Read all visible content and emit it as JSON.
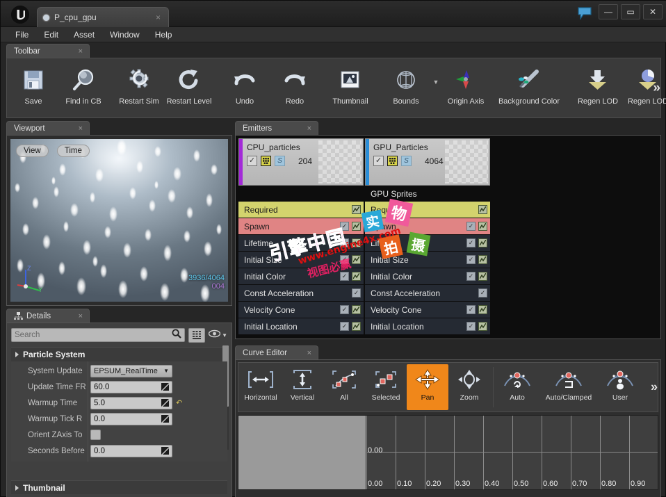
{
  "window": {
    "tab_label": "P_cpu_gpu",
    "tab_close": "×",
    "minimize": "—",
    "maximize": "▭",
    "close": "✕"
  },
  "menubar": {
    "items": [
      {
        "label": "File"
      },
      {
        "label": "Edit"
      },
      {
        "label": "Asset"
      },
      {
        "label": "Window"
      },
      {
        "label": "Help"
      }
    ]
  },
  "toolbar": {
    "tab_label": "Toolbar",
    "tab_close": "×",
    "more": "»",
    "buttons": [
      {
        "label": "Save",
        "icon": "save-icon"
      },
      {
        "label": "Find in CB",
        "icon": "find-in-content-browser-icon"
      },
      {
        "label": "Restart Sim",
        "icon": "restart-sim-icon"
      },
      {
        "label": "Restart Level",
        "icon": "restart-level-icon"
      },
      {
        "label": "Undo",
        "icon": "undo-icon"
      },
      {
        "label": "Redo",
        "icon": "redo-icon"
      },
      {
        "label": "Thumbnail",
        "icon": "thumbnail-icon"
      },
      {
        "label": "Bounds",
        "icon": "bounds-icon"
      },
      {
        "label": "Origin Axis",
        "icon": "origin-axis-icon"
      },
      {
        "label": "Background Color",
        "icon": "background-color-icon"
      },
      {
        "label": "Regen LOD",
        "icon": "regen-lod-down-icon"
      },
      {
        "label": "Regen LOD",
        "icon": "regen-lod-sphere-icon"
      }
    ]
  },
  "viewport": {
    "tab_label": "Viewport",
    "tab_close": "×",
    "view_button": "View",
    "time_button": "Time",
    "stats_line1": "3936/4064",
    "stats_line2": "004",
    "axis_z": "Z",
    "axis_y": "Y"
  },
  "details": {
    "tab_label": "Details",
    "tab_close": "×",
    "search_placeholder": "Search",
    "search_value": "",
    "section_title": "Particle System",
    "footer_title": "Thumbnail",
    "rows": [
      {
        "name": "System Update",
        "type": "combo",
        "value": "EPSUM_RealTime",
        "reset": false
      },
      {
        "name": "Update Time FR",
        "type": "number",
        "value": "60.0",
        "reset": false
      },
      {
        "name": "Warmup Time",
        "type": "number",
        "value": "5.0",
        "reset": true
      },
      {
        "name": "Warmup Tick R",
        "type": "number",
        "value": "0.0",
        "reset": false
      },
      {
        "name": "Orient ZAxis To",
        "type": "checkbox",
        "value": "",
        "reset": false
      },
      {
        "name": "Seconds Before",
        "type": "number",
        "value": "0.0",
        "reset": false
      }
    ]
  },
  "emitters": {
    "tab_label": "Emitters",
    "tab_close": "×",
    "columns": [
      {
        "name": "CPU_particles",
        "count": "204",
        "bar_color": "#a32ad8",
        "enabled": "✓",
        "solo": "S",
        "subhead": "",
        "modules": [
          {
            "label": "Required",
            "style": "required",
            "has_check": false,
            "has_curve": true
          },
          {
            "label": "Spawn",
            "style": "spawn",
            "has_check": true,
            "has_curve": true
          },
          {
            "label": "Lifetime",
            "style": "normal",
            "has_check": true,
            "has_curve": true
          },
          {
            "label": "Initial Size",
            "style": "normal",
            "has_check": true,
            "has_curve": true
          },
          {
            "label": "Initial Color",
            "style": "normal",
            "has_check": true,
            "has_curve": true
          },
          {
            "label": "Const Acceleration",
            "style": "normal",
            "has_check": true,
            "has_curve": false
          },
          {
            "label": "Velocity Cone",
            "style": "normal",
            "has_check": true,
            "has_curve": true
          },
          {
            "label": "Initial Location",
            "style": "normal",
            "has_check": true,
            "has_curve": true
          }
        ]
      },
      {
        "name": "GPU_Particles",
        "count": "4064",
        "bar_color": "#2a8ed8",
        "enabled": "✓",
        "solo": "S",
        "subhead": "GPU Sprites",
        "modules": [
          {
            "label": "Required",
            "style": "required",
            "has_check": false,
            "has_curve": true
          },
          {
            "label": "Spawn",
            "style": "spawn",
            "has_check": true,
            "has_curve": true
          },
          {
            "label": "Lifetime",
            "style": "normal",
            "has_check": true,
            "has_curve": true
          },
          {
            "label": "Initial Size",
            "style": "normal",
            "has_check": true,
            "has_curve": true
          },
          {
            "label": "Initial Color",
            "style": "normal",
            "has_check": true,
            "has_curve": true
          },
          {
            "label": "Const Acceleration",
            "style": "normal",
            "has_check": true,
            "has_curve": false
          },
          {
            "label": "Velocity Cone",
            "style": "normal",
            "has_check": true,
            "has_curve": true
          },
          {
            "label": "Initial Location",
            "style": "normal",
            "has_check": true,
            "has_curve": true
          }
        ]
      }
    ]
  },
  "curve_editor": {
    "tab_label": "Curve Editor",
    "tab_close": "×",
    "more": "»",
    "buttons": [
      {
        "label": "Horizontal",
        "icon": "fit-horizontal-icon",
        "active": false
      },
      {
        "label": "Vertical",
        "icon": "fit-vertical-icon",
        "active": false
      },
      {
        "label": "All",
        "icon": "fit-all-icon",
        "active": false
      },
      {
        "label": "Selected",
        "icon": "fit-selected-icon",
        "active": false
      },
      {
        "label": "Pan",
        "icon": "pan-icon",
        "active": true
      },
      {
        "label": "Zoom",
        "icon": "zoom-icon",
        "active": false
      },
      {
        "label": "Auto",
        "icon": "tangent-auto-icon",
        "active": false
      },
      {
        "label": "Auto/Clamped",
        "icon": "tangent-auto-clamped-icon",
        "active": false
      },
      {
        "label": "User",
        "icon": "tangent-user-icon",
        "active": false
      }
    ]
  },
  "chart_data": {
    "type": "line",
    "title": "Curve Editor",
    "xlabel": "",
    "ylabel": "",
    "x_ticks": [
      "0.00",
      "0.10",
      "0.20",
      "0.30",
      "0.40",
      "0.50",
      "0.60",
      "0.70",
      "0.80",
      "0.90"
    ],
    "y_ticks": [
      "0.00"
    ],
    "xlim": [
      0.0,
      1.0
    ],
    "ylim": [
      -0.5,
      0.5
    ],
    "grid": true,
    "legend_position": "none",
    "series": []
  },
  "watermarks": {
    "cn_main": "引擎中国",
    "url": "www.engine4x.com",
    "cn_sub": "视图必赢",
    "badge1": "实",
    "badge2": "物",
    "badge3": "拍",
    "badge4": "摄"
  }
}
